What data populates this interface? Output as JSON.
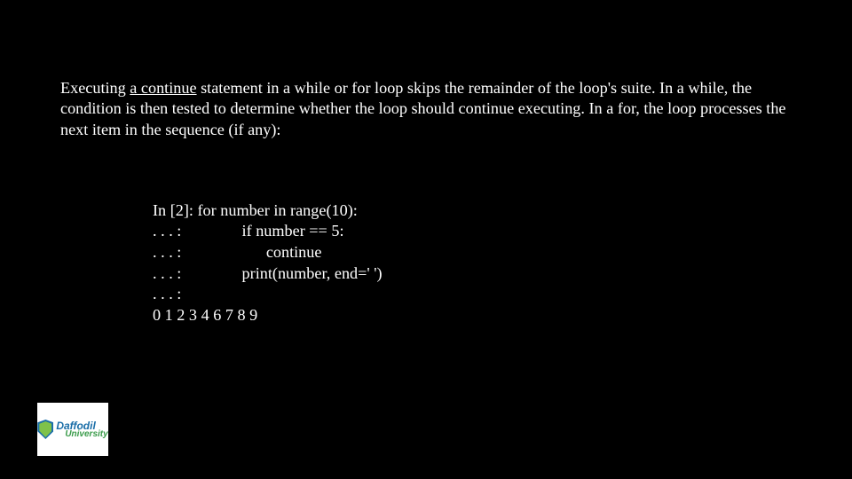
{
  "para": {
    "prefix": "Executing ",
    "underlined": "a continue",
    "suffix": " statement in a while or for loop skips the remainder of the loop's suite. In a while, the condition is then tested to determine whether the loop should continue executing. In a for, the loop processes the next item in the sequence (if any):"
  },
  "code": {
    "line1": "In [2]: for number in range(10):",
    "line2": ". . . :               if number == 5:",
    "line3": ". . . :                     continue",
    "line4": ". . . :               print(number, end=' ')",
    "line5": ". . . :",
    "line6": "0 1 2 3 4 6 7 8 9"
  },
  "logo": {
    "main": "Daffodil",
    "sub": "University"
  }
}
